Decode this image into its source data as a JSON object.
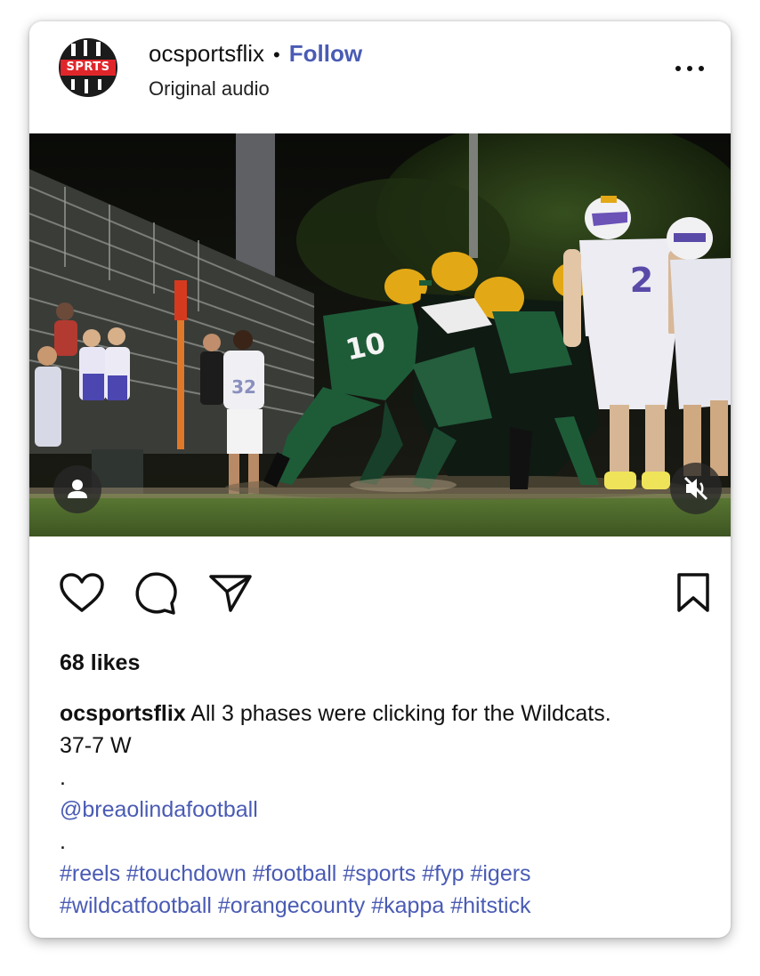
{
  "post": {
    "username": "ocsportsflix",
    "separator": "•",
    "follow_label": "Follow",
    "audio_label": "Original audio",
    "avatar_logo_text": "SPRTS",
    "likes_text": "68 likes",
    "caption": {
      "username": "ocsportsflix",
      "text": " All 3 phases were clicking for the Wildcats.",
      "line2": "37-7 W",
      "dot1": ".",
      "mention": "@breaolindafootball",
      "dot2": ".",
      "hashtags_line1": [
        "#reels",
        "#touchdown",
        "#football",
        "#sports",
        "#fyp",
        "#igers"
      ],
      "hashtags_line2": [
        "#wildcatfootball",
        "#orangecounty",
        "#kappa",
        "#hitstick"
      ]
    }
  },
  "media": {
    "jersey_numbers": [
      "10",
      "2",
      "32"
    ],
    "user_badge_icon": "user-icon",
    "mute_badge_icon": "speaker-muted-icon"
  },
  "actions": {
    "like_icon": "heart-icon",
    "comment_icon": "comment-icon",
    "share_icon": "paper-plane-icon",
    "save_icon": "bookmark-icon"
  },
  "colors": {
    "link": "#4a5bb4",
    "text": "#111111",
    "field_green": "#4f6b2c",
    "jersey_green": "#1e5c38",
    "helmet_gold": "#e3a816",
    "away_white": "#eeeeee",
    "away_purple": "#5a4aa8"
  }
}
